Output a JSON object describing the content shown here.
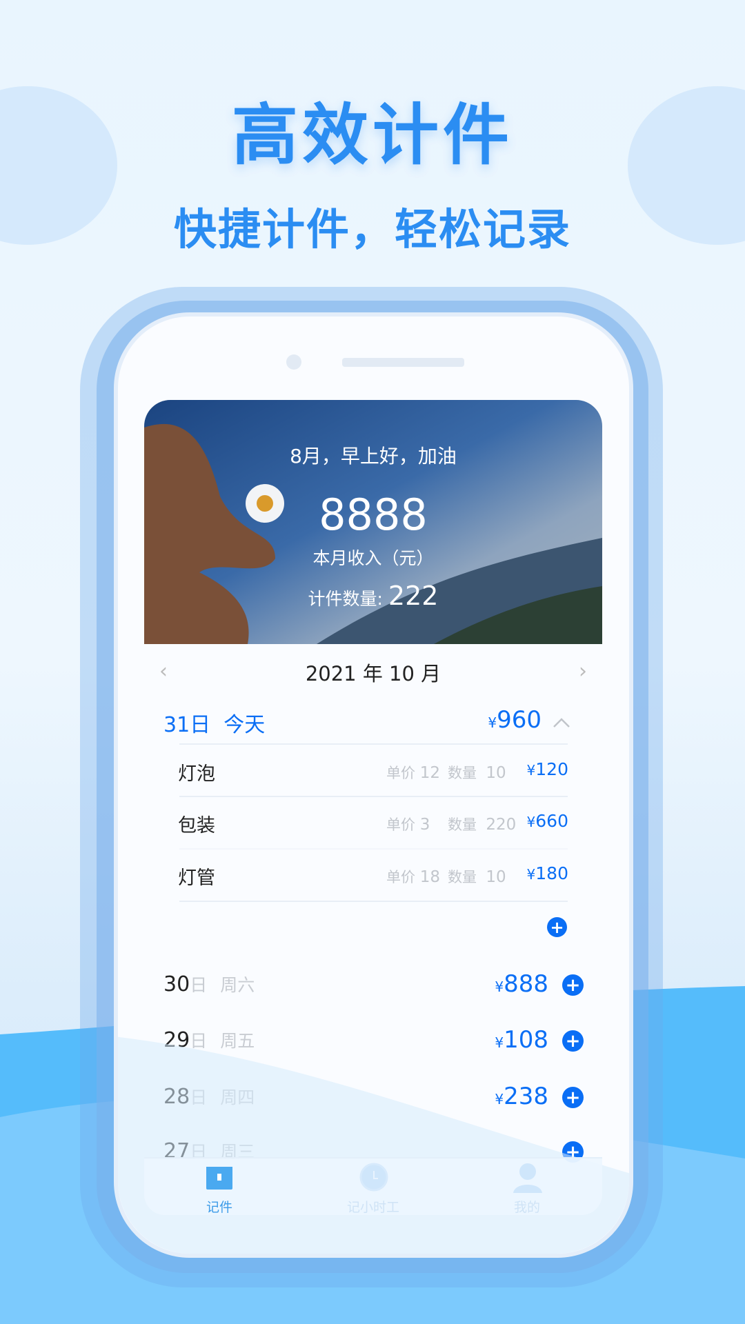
{
  "hero": {
    "title": "高效计件",
    "subtitle": "快捷计件，轻松记录"
  },
  "colors": {
    "accent": "#0a6ef5",
    "hero": "#2b8df2",
    "wave": "#4db8fb"
  },
  "card": {
    "greeting": "8月，早上好，加油",
    "income": "8888",
    "income_label": "本月收入（元）",
    "count_label": "计件数量:",
    "count": "222"
  },
  "month_nav": {
    "label": "2021 年 10 月",
    "prev_icon": "chevron-left-icon",
    "next_icon": "chevron-right-icon"
  },
  "today": {
    "day": "31日",
    "label": "今天",
    "currency": "¥",
    "total": "960",
    "items": [
      {
        "name": "灯泡",
        "price_label": "单价",
        "price": "12",
        "qty_label": "数量",
        "qty": "10",
        "currency": "¥",
        "amount": "120"
      },
      {
        "name": "包装",
        "price_label": "单价",
        "price": "3",
        "qty_label": "数量",
        "qty": "220",
        "currency": "¥",
        "amount": "660"
      },
      {
        "name": "灯管",
        "price_label": "单价",
        "price": "18",
        "qty_label": "数量",
        "qty": "10",
        "currency": "¥",
        "amount": "180"
      }
    ]
  },
  "days": [
    {
      "num": "30",
      "suffix": "日",
      "weekday": "周六",
      "currency": "¥",
      "amount": "888"
    },
    {
      "num": "29",
      "suffix": "日",
      "weekday": "周五",
      "currency": "¥",
      "amount": "108"
    },
    {
      "num": "28",
      "suffix": "日",
      "weekday": "周四",
      "currency": "¥",
      "amount": "238"
    },
    {
      "num": "27",
      "suffix": "日",
      "weekday": "周三",
      "currency": "",
      "amount": ""
    }
  ],
  "tabs": [
    {
      "label": "记件",
      "icon": "box-icon",
      "active": true
    },
    {
      "label": "记小时工",
      "icon": "clock-icon"
    },
    {
      "label": "我的",
      "icon": "user-icon"
    }
  ]
}
